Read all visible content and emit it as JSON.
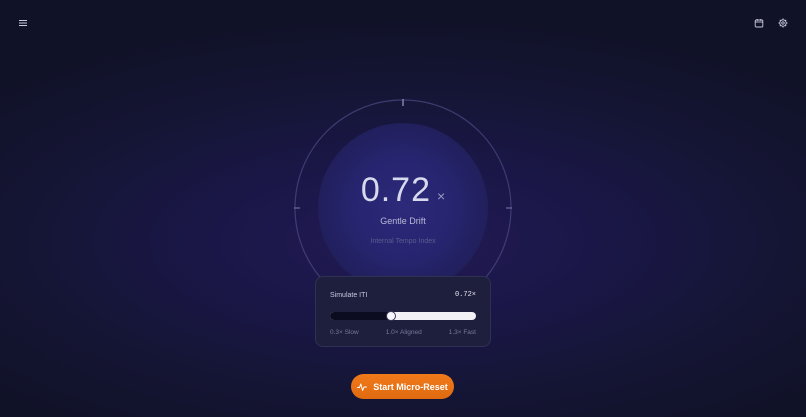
{
  "header": {
    "menu_icon": "menu-icon",
    "calendar_icon": "calendar-icon",
    "settings_icon": "gear-icon"
  },
  "dial": {
    "value": "0.72",
    "unit": "×",
    "state": "Gentle Drift",
    "caption": "Internal Tempo Index"
  },
  "simulator": {
    "title": "Simulate ITI",
    "value_display": "0.72×",
    "min": 0.3,
    "max": 1.3,
    "value": 0.72,
    "ticks": [
      "0.3× Slow",
      "1.0× Aligned",
      "1.3× Fast"
    ]
  },
  "action": {
    "label": "Start Micro-Reset",
    "icon": "activity-icon"
  },
  "colors": {
    "accent": "#f07a1a",
    "background": "#141533",
    "glow": "#2c2a7a"
  }
}
